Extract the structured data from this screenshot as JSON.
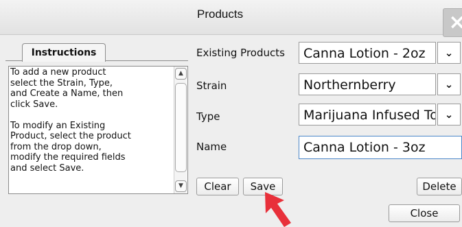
{
  "window": {
    "title": "Products",
    "close_glyph": "×"
  },
  "instructions": {
    "tab_label": "Instructions",
    "text": "To add a new product\nselect the Strain, Type,\nand Create a Name, then\nclick Save.\n\nTo modify an Existing\nProduct, select the product\nfrom the drop down,\nmodify the required fields\nand select Save."
  },
  "form": {
    "existing_label": "Existing Products",
    "existing_value": "Canna Lotion - 2oz",
    "strain_label": "Strain",
    "strain_value": "Northernberry",
    "type_label": "Type",
    "type_value": "Marijuana Infused Topical",
    "name_label": "Name",
    "name_value": "Canna Lotion - 3oz"
  },
  "buttons": {
    "clear": "Clear",
    "save": "Save",
    "delete": "Delete",
    "close": "Close"
  },
  "colors": {
    "pointer_arrow": "#e8303a",
    "focus_border": "#4a86c8"
  },
  "icons": {
    "dropdown": "chevron-down-icon",
    "pointer": "red-arrow-pointer-icon"
  }
}
